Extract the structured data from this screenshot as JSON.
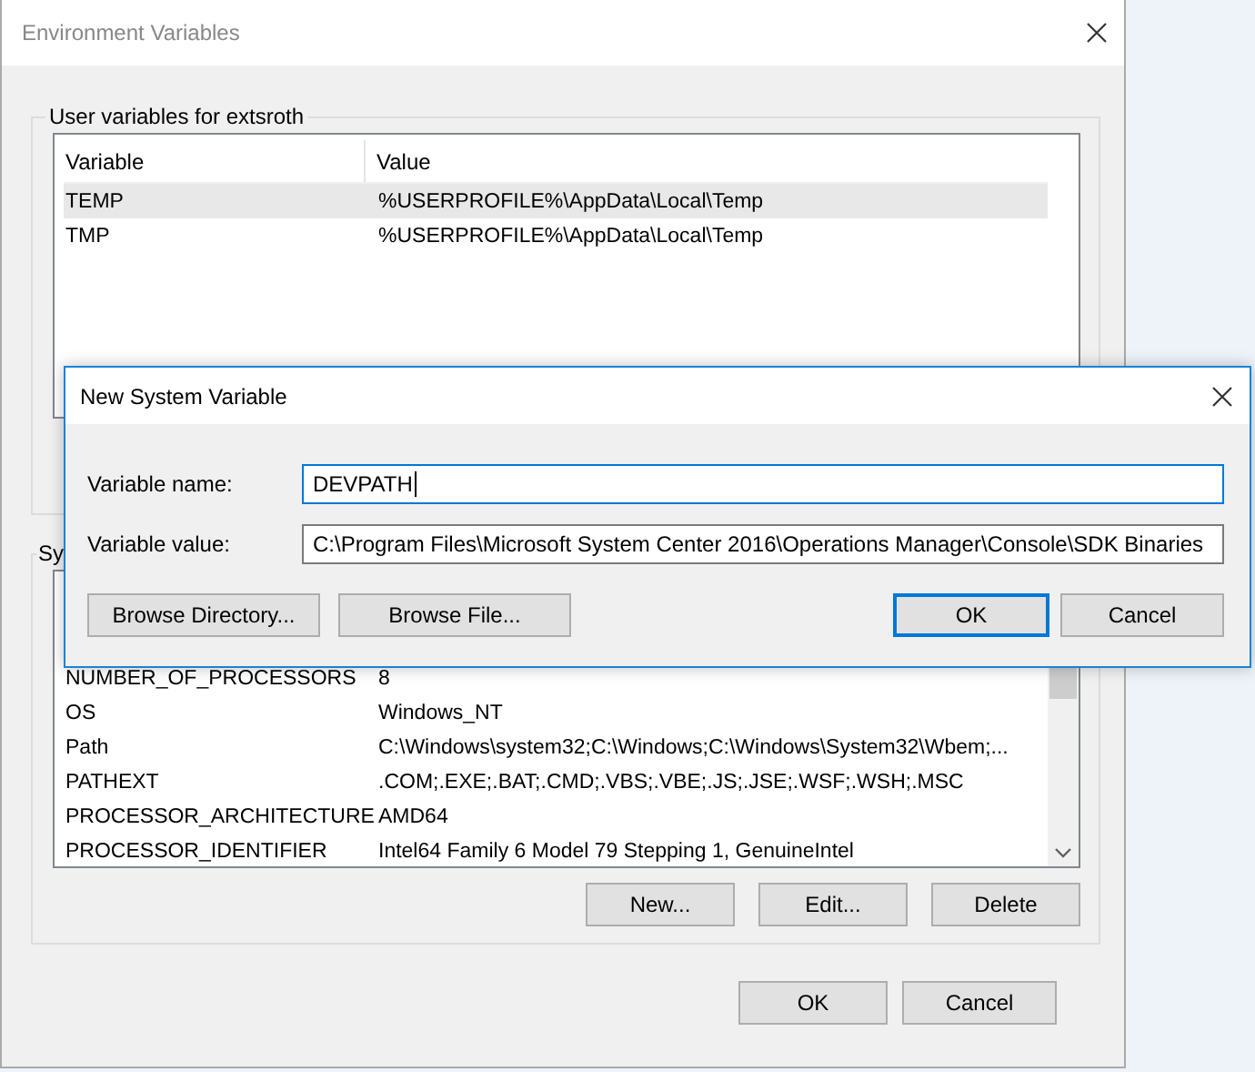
{
  "window": {
    "title": "Environment Variables"
  },
  "user_variables": {
    "title": "User variables for extsroth",
    "columns": [
      "Variable",
      "Value"
    ],
    "rows": [
      {
        "variable": "TEMP",
        "value": "%USERPROFILE%\\AppData\\Local\\Temp",
        "selected": true
      },
      {
        "variable": "TMP",
        "value": "%USERPROFILE%\\AppData\\Local\\Temp",
        "selected": false
      }
    ]
  },
  "system_variables": {
    "title": "Sy",
    "rows": [
      {
        "variable": "NUMBER_OF_PROCESSORS",
        "value": "8",
        "selected": false
      },
      {
        "variable": "OS",
        "value": "Windows_NT",
        "selected": false
      },
      {
        "variable": "Path",
        "value": "C:\\Windows\\system32;C:\\Windows;C:\\Windows\\System32\\Wbem;...",
        "selected": false
      },
      {
        "variable": "PATHEXT",
        "value": ".COM;.EXE;.BAT;.CMD;.VBS;.VBE;.JS;.JSE;.WSF;.WSH;.MSC",
        "selected": false
      },
      {
        "variable": "PROCESSOR_ARCHITECTURE",
        "value": "AMD64",
        "selected": false
      },
      {
        "variable": "PROCESSOR_IDENTIFIER",
        "value": "Intel64 Family 6 Model 79 Stepping 1, GenuineIntel",
        "selected": false
      }
    ],
    "buttons": [
      "New...",
      "Edit...",
      "Delete"
    ]
  },
  "buttons": [
    {
      "label": "OK",
      "default": false
    },
    {
      "label": "Cancel",
      "default": false
    }
  ],
  "dialog": {
    "title": "New System Variable",
    "fields": [
      {
        "label": "Variable name:",
        "value": "DEVPATH",
        "focused": true
      },
      {
        "label": "Variable value:",
        "value": "C:\\Program Files\\Microsoft System Center 2016\\Operations Manager\\Console\\SDK Binaries",
        "focused": false
      }
    ],
    "left_buttons": [
      "Browse Directory...",
      "Browse File..."
    ],
    "buttons": [
      {
        "label": "OK",
        "default": true
      },
      {
        "label": "Cancel",
        "default": false
      }
    ]
  }
}
